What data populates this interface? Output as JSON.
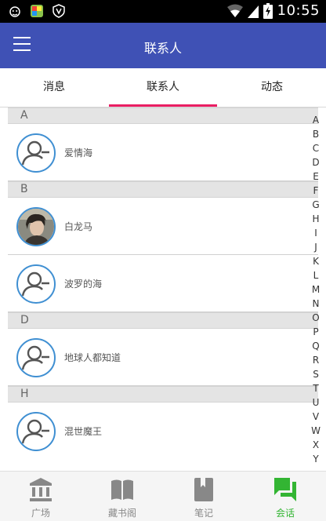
{
  "status_bar": {
    "time": "10:55"
  },
  "app_bar": {
    "title": "联系人"
  },
  "tabs": [
    {
      "label": "消息"
    },
    {
      "label": "联系人",
      "selected": true
    },
    {
      "label": "动态"
    }
  ],
  "sections": [
    {
      "letter": "A",
      "contacts": [
        {
          "name": "爱情海",
          "avatar": "default-avatar-icon"
        }
      ]
    },
    {
      "letter": "B",
      "contacts": [
        {
          "name": "白龙马",
          "avatar": "photo-avatar"
        },
        {
          "name": "波罗的海",
          "avatar": "default-avatar-icon"
        }
      ]
    },
    {
      "letter": "D",
      "contacts": [
        {
          "name": "地球人都知道",
          "avatar": "default-avatar-icon"
        }
      ]
    },
    {
      "letter": "H",
      "contacts": [
        {
          "name": "混世魔王",
          "avatar": "default-avatar-icon"
        }
      ]
    }
  ],
  "index_letters": [
    "A",
    "B",
    "C",
    "D",
    "E",
    "F",
    "G",
    "H",
    "I",
    "J",
    "K",
    "L",
    "M",
    "N",
    "O",
    "P",
    "Q",
    "R",
    "S",
    "T",
    "U",
    "V",
    "W",
    "X",
    "Y"
  ],
  "bottom_nav": [
    {
      "label": "广场",
      "icon": "bank-icon"
    },
    {
      "label": "藏书阁",
      "icon": "book-icon"
    },
    {
      "label": "笔记",
      "icon": "bookmark-icon"
    },
    {
      "label": "会话",
      "icon": "chat-icon",
      "active": true
    }
  ],
  "colors": {
    "primary": "#3f51b5",
    "accent": "#e91e63",
    "avatar_border": "#3f8fd2",
    "active_nav": "#33b533"
  }
}
